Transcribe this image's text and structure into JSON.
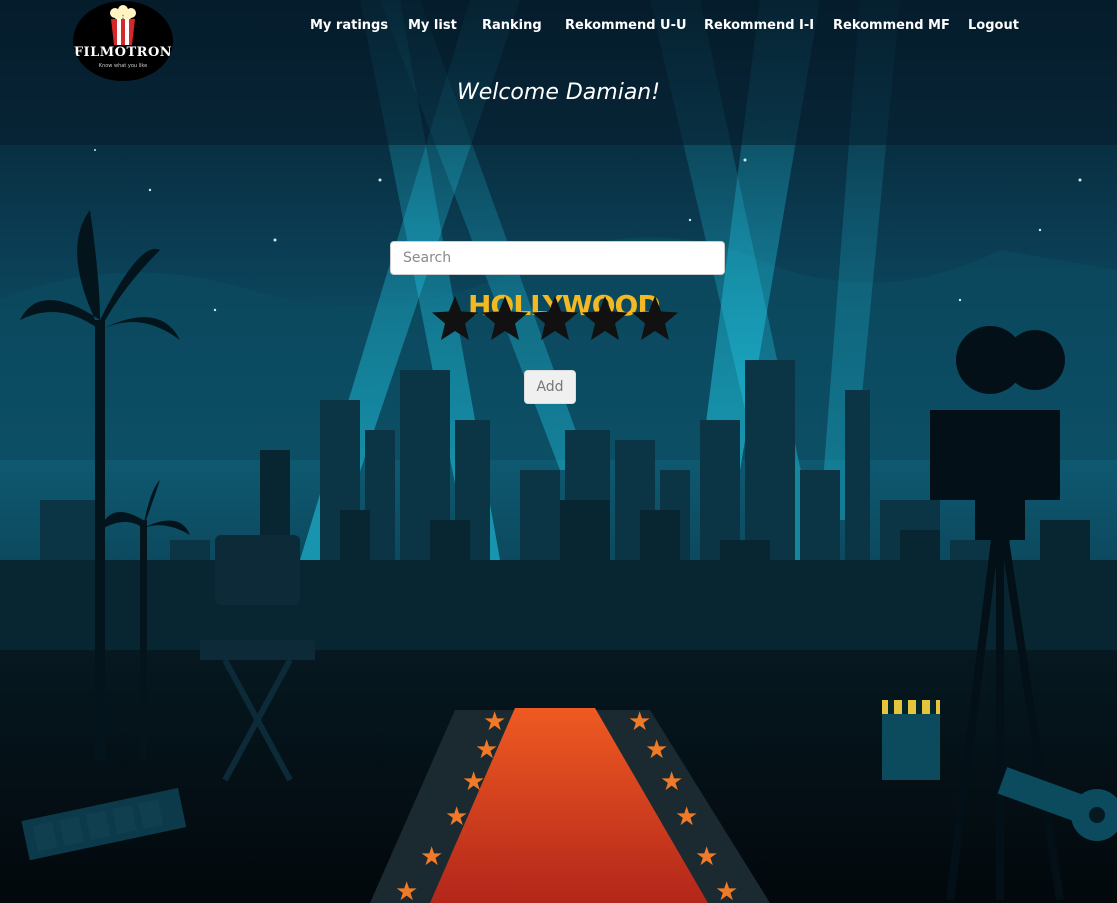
{
  "brand": {
    "name": "FILMOTRON",
    "tagline": "Know what you like"
  },
  "nav": {
    "items": [
      {
        "label": "My ratings"
      },
      {
        "label": "My list"
      },
      {
        "label": "Ranking"
      },
      {
        "label": "Rekommend U-U"
      },
      {
        "label": "Rekommend I-I"
      },
      {
        "label": "Rekommend MF"
      },
      {
        "label": "Logout"
      }
    ]
  },
  "main": {
    "welcome": "Welcome Damian!",
    "search_placeholder": "Search",
    "search_value": "",
    "rating": {
      "max": 5,
      "selected": 0
    },
    "add_label": "Add",
    "background_sign": "HOLLYWOOD"
  },
  "colors": {
    "star_fill": "#111111",
    "nav_text": "#ffffff",
    "carpet": "#e8431e",
    "sky_top": "#082a3c",
    "sky_mid": "#0d5b74"
  },
  "icons": {
    "logo": "popcorn-icon",
    "rating": "star-icon"
  }
}
